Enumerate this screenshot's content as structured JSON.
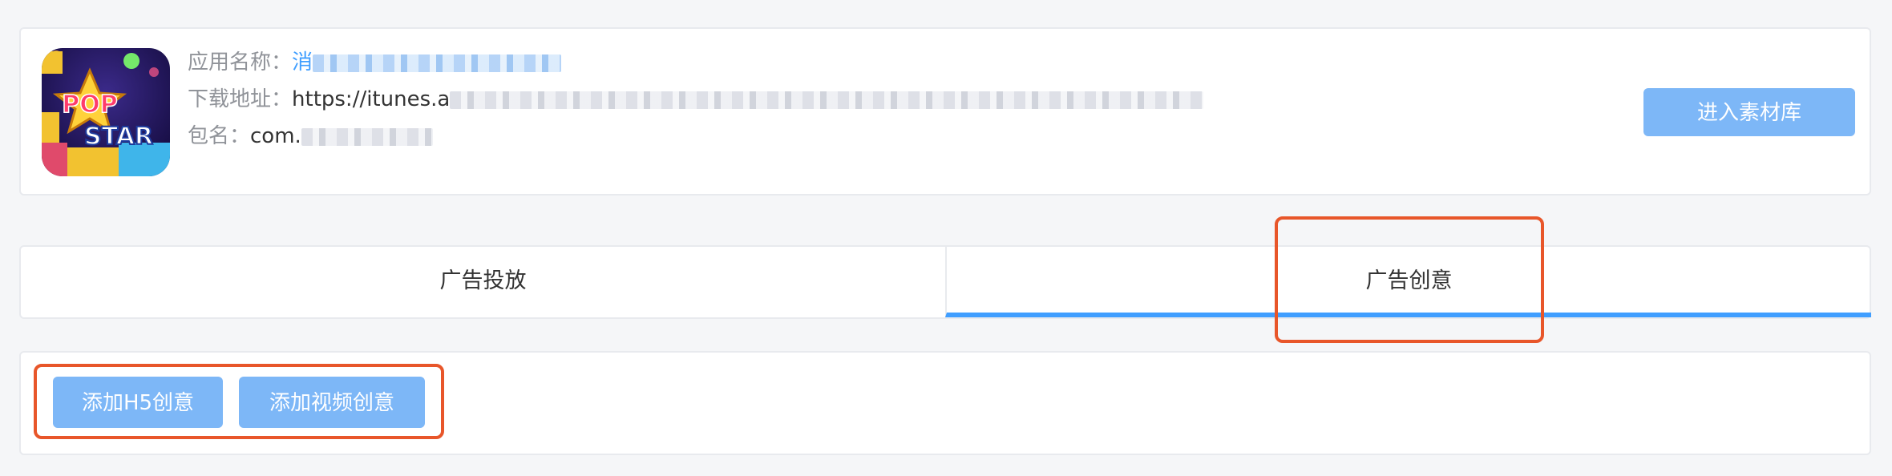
{
  "app": {
    "name_label": "应用名称：",
    "name_value": "消",
    "url_label": "下载地址：",
    "url_value": "https://itunes.a",
    "package_label": "包名：",
    "package_value": "com.",
    "icon_alt": "POP STAR",
    "icon_word1": "POP",
    "icon_word2": "STAR",
    "library_button": "进入素材库"
  },
  "tabs": [
    {
      "label": "广告投放",
      "active": false
    },
    {
      "label": "广告创意",
      "active": true
    }
  ],
  "actions": {
    "add_h5": "添加H5创意",
    "add_video": "添加视频创意"
  },
  "colors": {
    "accent": "#409eff",
    "button": "#7db7f7",
    "highlight": "#e8562a",
    "background": "#f5f6f8"
  }
}
